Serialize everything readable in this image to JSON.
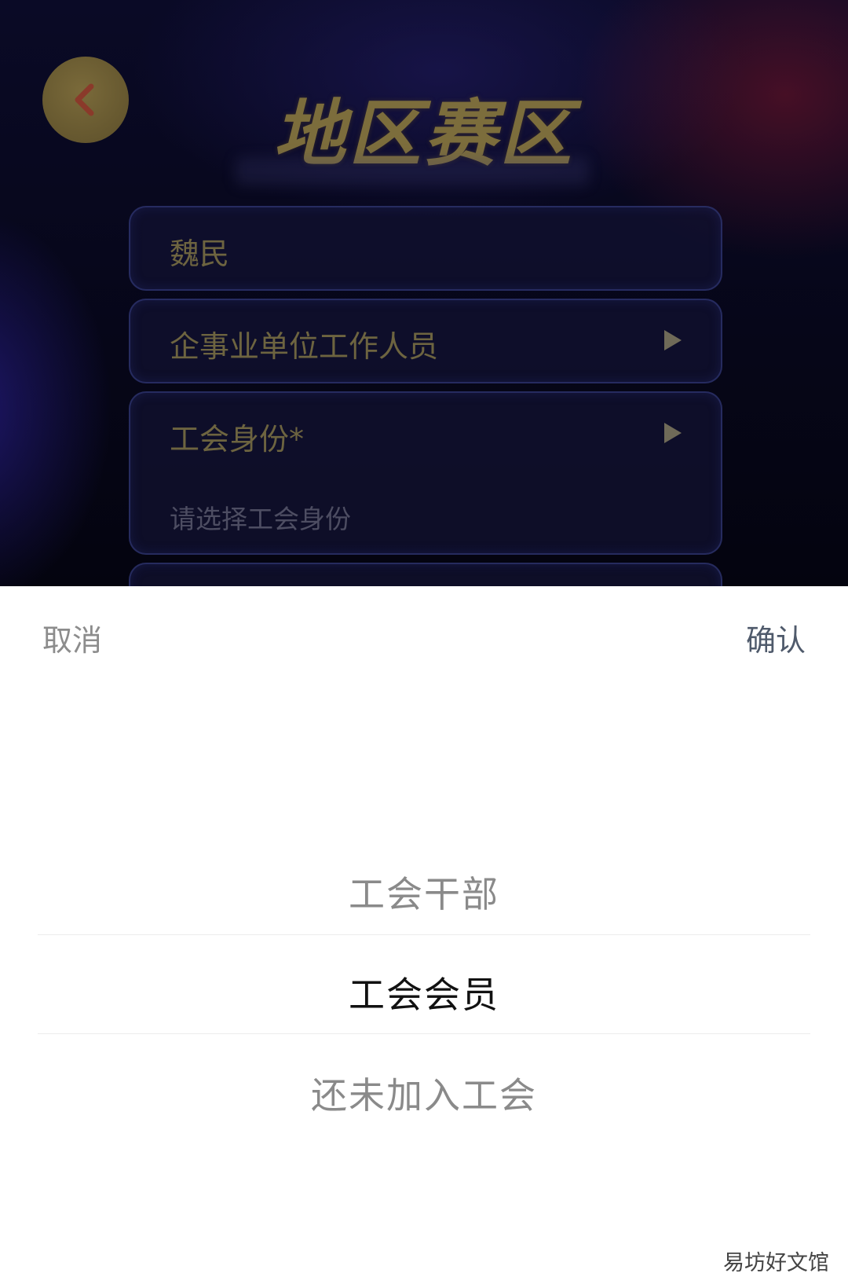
{
  "header": {
    "title": "地区赛区",
    "back_icon": "chevron-left-icon"
  },
  "form": {
    "name_value": "魏民",
    "occupation_value": "企事业单位工作人员",
    "union_label": "工会身份*",
    "union_placeholder": "请选择工会身份"
  },
  "picker": {
    "cancel_label": "取消",
    "confirm_label": "确认",
    "options": [
      {
        "label": "工会干部"
      },
      {
        "label": "工会会员"
      },
      {
        "label": "还未加入工会"
      }
    ],
    "selected": "工会会员"
  },
  "watermark": "易坊好文馆",
  "colors": {
    "title_gold": "#7c6d3c",
    "back_button": "#6b5c33",
    "back_chevron": "#8a3a2a",
    "selected_text": "#111111",
    "dim_text": "#8a8a8a"
  }
}
